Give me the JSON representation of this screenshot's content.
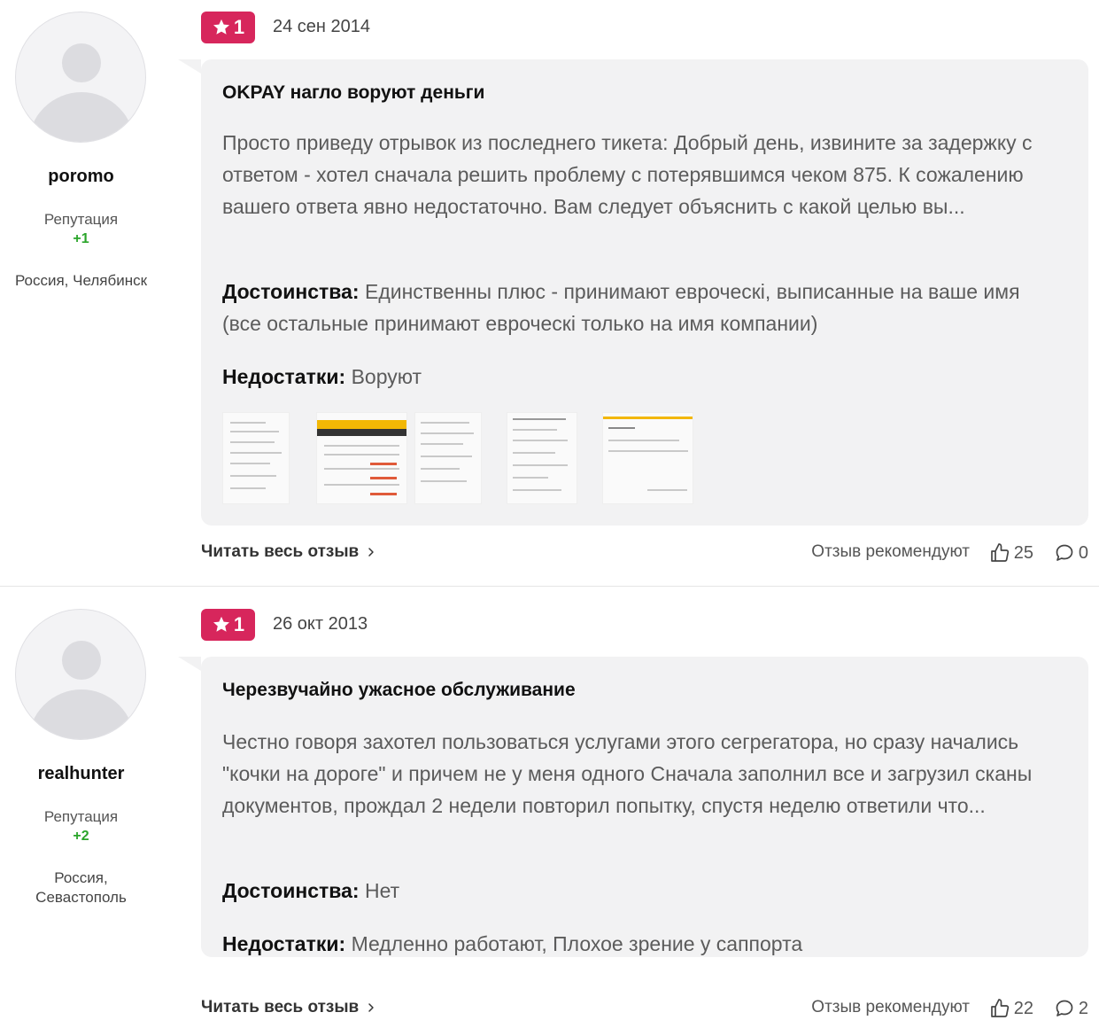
{
  "reviews": [
    {
      "author": {
        "username": "poromo",
        "reputation_label": "Репутация",
        "reputation_value": "+1",
        "location": "Россия, Челябинск"
      },
      "rating": "1",
      "date": "24 сен 2014",
      "title": "OKPAY нагло воруют деньги",
      "body": "Просто приведу отрывок из последнего тикета: Добрый день, извините за задержку с ответом - хотел сначала решить проблему с потерявшимся чеком 875. К сожалению вашего ответа явно недостаточно. Вам следует объяснить с какой целью вы...",
      "pros_label": "Достоинства:",
      "pros": "Единственны плюс - принимают евроческі, выписанные на ваше имя (все остальные принимают евроческі только на имя компании)",
      "cons_label": "Недостатки:",
      "cons": "Воруют",
      "footer": {
        "read_more": "Читать весь отзыв",
        "recommend": "Отзыв рекомендуют",
        "likes": "25",
        "comments": "0"
      }
    },
    {
      "author": {
        "username": "realhunter",
        "reputation_label": "Репутация",
        "reputation_value": "+2",
        "location": "Россия, Севастополь"
      },
      "rating": "1",
      "date": "26 окт 2013",
      "title": "Черезвучайно ужасное обслуживание",
      "body": "Честно говоря захотел пользоваться услугами этого сегрегатора, но сразу начались \"кочки на дороге\" и причем не у меня одного Сначала заполнил все и загрузил сканы документов, прождал 2 недели повторил попытку, спустя неделю ответили что...",
      "pros_label": "Достоинства:",
      "pros": "Нет",
      "cons_label": "Недостатки:",
      "cons": "Медленно работают, Плохое зрение у саппорта",
      "footer": {
        "read_more": "Читать весь отзыв",
        "recommend": "Отзыв рекомендуют",
        "likes": "22",
        "comments": "2"
      }
    }
  ],
  "icons": {
    "rating": "star-icon",
    "read_more": "chevron-right-icon",
    "likes": "thumbs-up-icon",
    "comments": "comment-icon"
  },
  "colors": {
    "rating_badge": "#d7265c",
    "reputation": "#2aa52a",
    "card_bg": "#f2f2f3"
  }
}
